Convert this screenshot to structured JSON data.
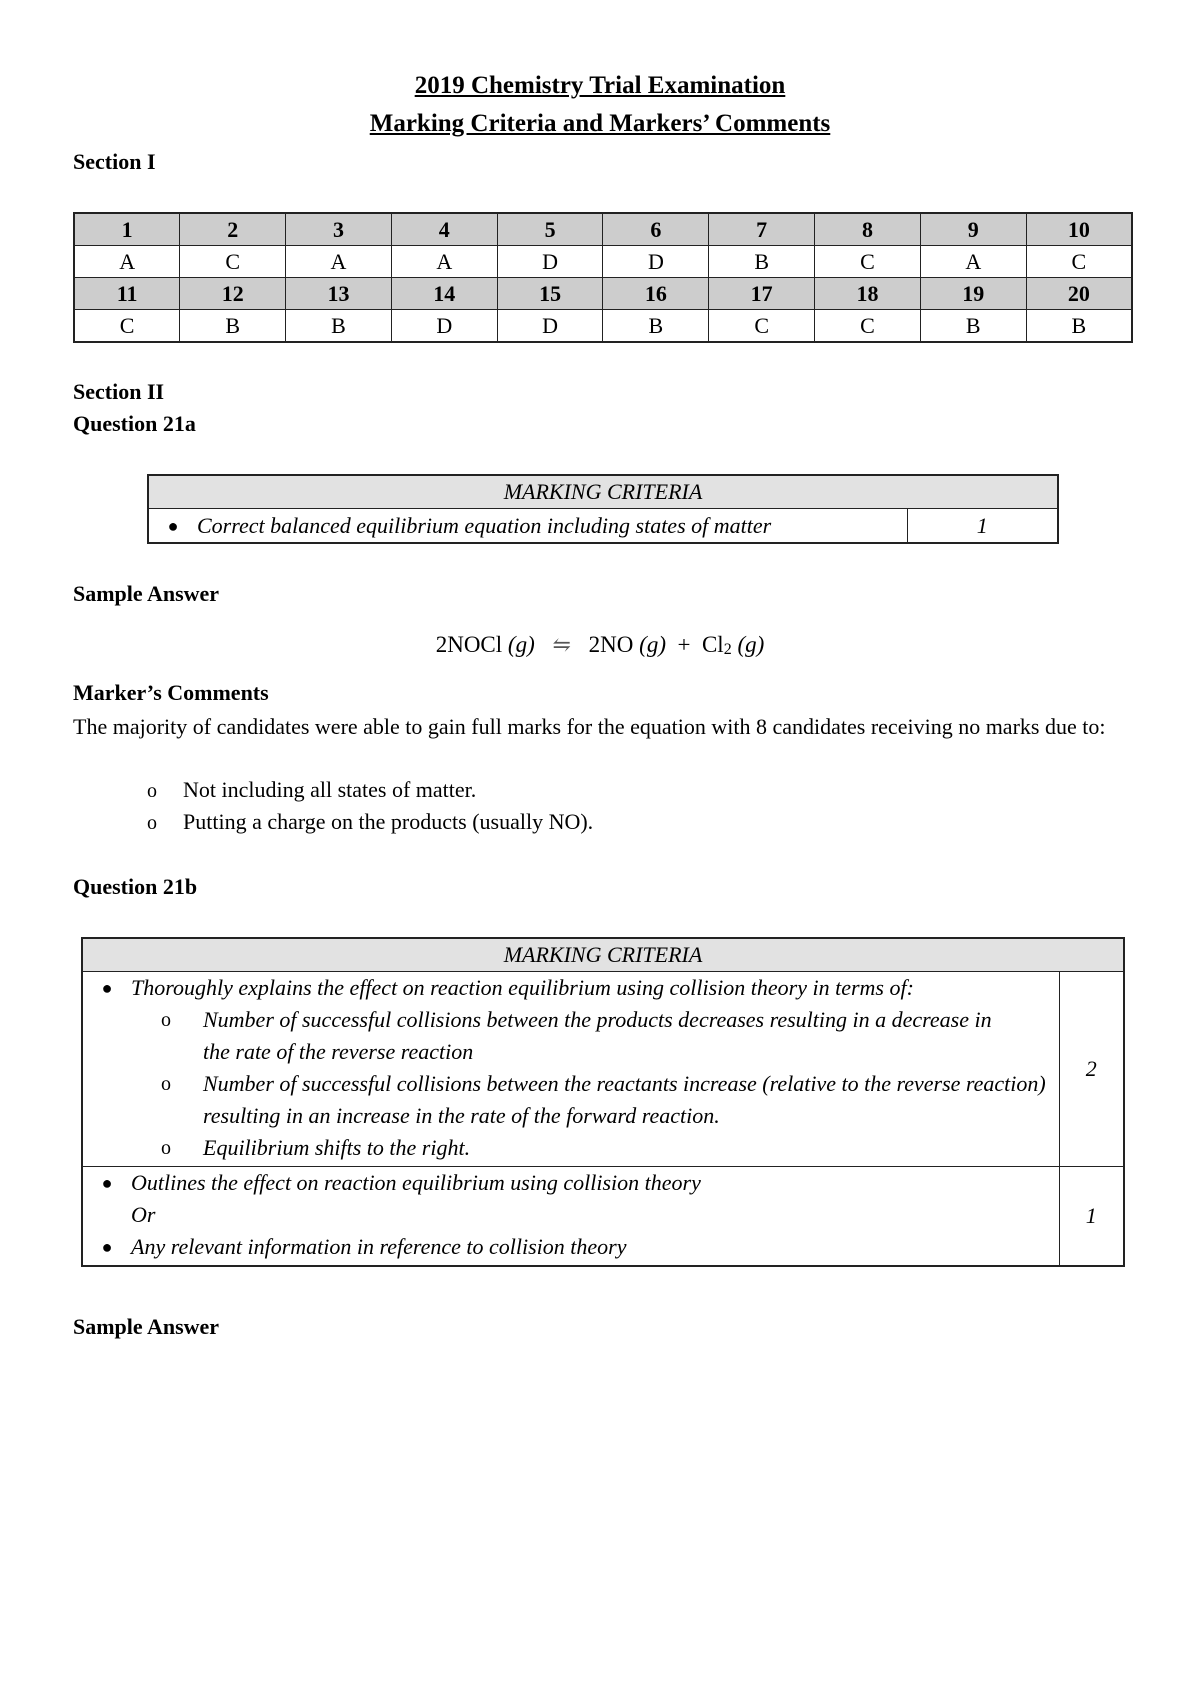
{
  "header": {
    "title_line1": "2019 Chemistry Trial Examination",
    "title_line2": "Marking Criteria and Markers’ Comments"
  },
  "section1": {
    "heading": "Section I",
    "rows": [
      {
        "questions": [
          "1",
          "2",
          "3",
          "4",
          "5",
          "6",
          "7",
          "8",
          "9",
          "10"
        ],
        "answers": [
          "A",
          "C",
          "A",
          "A",
          "D",
          "D",
          "B",
          "C",
          "A",
          "C"
        ]
      },
      {
        "questions": [
          "11",
          "12",
          "13",
          "14",
          "15",
          "16",
          "17",
          "18",
          "19",
          "20"
        ],
        "answers": [
          "C",
          "B",
          "B",
          "D",
          "D",
          "B",
          "C",
          "C",
          "B",
          "B"
        ]
      }
    ]
  },
  "section2": {
    "heading": "Section II",
    "q21a": {
      "heading": "Question 21a",
      "criteria_header": "MARKING CRITERIA",
      "criteria": [
        {
          "text": "Correct balanced equilibrium equation including states of matter",
          "mark": "1"
        }
      ],
      "sample_answer_heading": "Sample Answer",
      "equation": {
        "reactant": "2NOCl",
        "reactant_state": "(g)",
        "arrow": "⇋",
        "product1": "2NO",
        "product1_state": "(g)",
        "plus": "+",
        "product2": "Cl",
        "product2_sub": "2",
        "product2_state": "(g)"
      },
      "comments_heading": "Marker’s Comments",
      "comments_text": "The majority of candidates were able to gain full marks for the equation with 8 candidates receiving no marks due to:",
      "comments_list": [
        "Not including all states of matter.",
        "Putting a charge on the products (usually NO)."
      ]
    },
    "q21b": {
      "heading": "Question 21b",
      "criteria_header": "MARKING CRITERIA",
      "band2": {
        "mark": "2",
        "main": "Thoroughly explains the effect on reaction equilibrium using collision theory in terms of:",
        "subpoints": [
          "Number of successful collisions between the products decreases resulting in a decrease in the rate of the reverse reaction",
          "Number of successful collisions between the reactants increase (relative to the reverse reaction) resulting in an increase in the rate of the forward reaction.",
          "Equilibrium shifts to the right."
        ]
      },
      "band1": {
        "mark": "1",
        "point1": "Outlines the effect on reaction equilibrium using collision theory",
        "or": "Or",
        "point2": "Any relevant information in reference to collision theory"
      },
      "sample_answer_heading": "Sample Answer"
    }
  }
}
